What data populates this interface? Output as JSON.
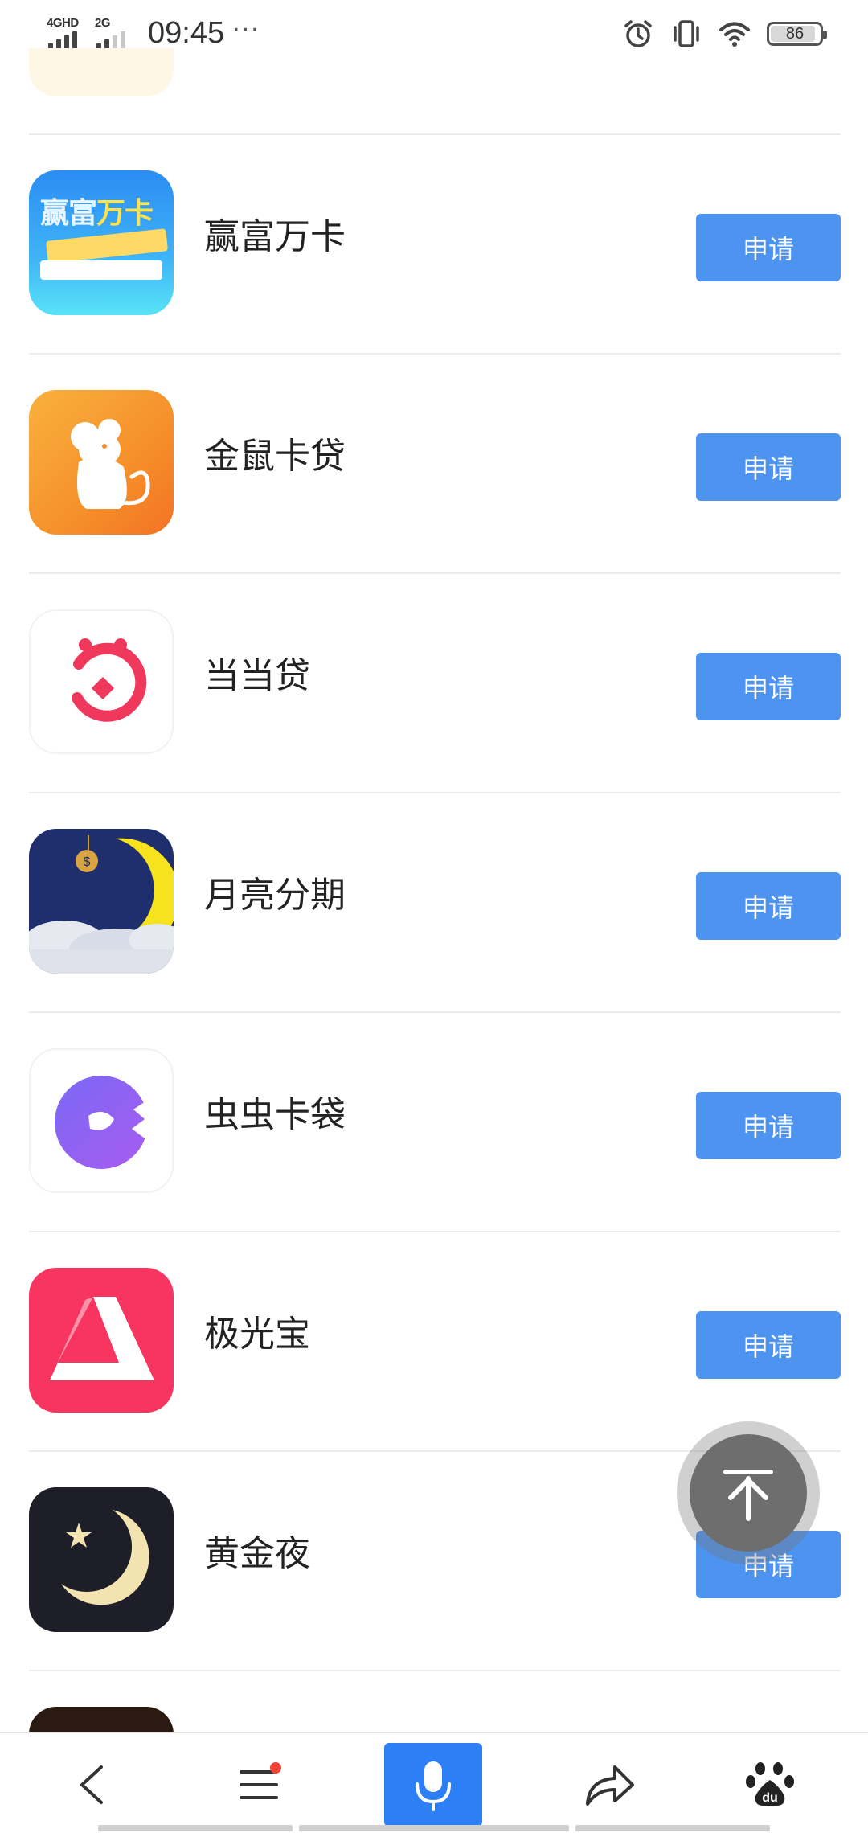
{
  "status_bar": {
    "sim1_network": "4GHD",
    "sim2_network": "2G",
    "time": "09:45",
    "overflow": "···",
    "battery_level": "86",
    "icons": [
      "alarm-icon",
      "vibrate-icon",
      "wifi-icon",
      "battery-icon"
    ]
  },
  "loan_list": [
    {
      "name": "赢富万卡",
      "button": "申请",
      "icon": "yingfu-wanka-icon",
      "icon_text_a": "赢富",
      "icon_text_b": "万卡"
    },
    {
      "name": "金鼠卡贷",
      "button": "申请",
      "icon": "golden-mouse-icon"
    },
    {
      "name": "当当贷",
      "button": "申请",
      "icon": "dangdang-dai-icon"
    },
    {
      "name": "月亮分期",
      "button": "申请",
      "icon": "moon-installment-icon",
      "icon_text": "$"
    },
    {
      "name": "虫虫卡袋",
      "button": "申请",
      "icon": "chongchong-icon"
    },
    {
      "name": "极光宝",
      "button": "申请",
      "icon": "aurora-bao-icon"
    },
    {
      "name": "黄金夜",
      "button": "申请",
      "icon": "golden-night-icon"
    }
  ],
  "bottom_nav": {
    "items": [
      "back-icon",
      "menu-icon",
      "microphone-icon",
      "share-icon",
      "baidu-paw-icon"
    ],
    "home_logo_text": "du"
  },
  "colors": {
    "accent": "#4d93f0",
    "voice_button": "#2d7ff6",
    "badge": "#f04438"
  }
}
